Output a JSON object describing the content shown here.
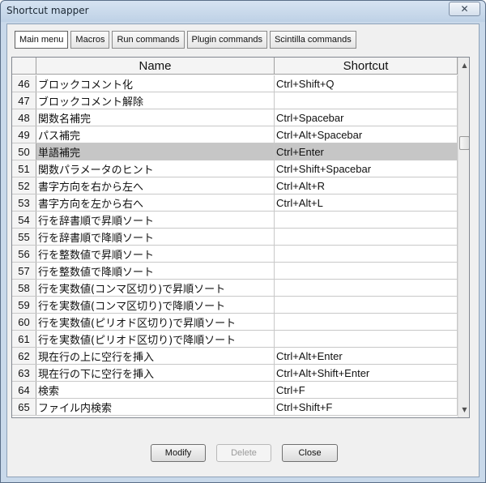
{
  "window": {
    "title": "Shortcut mapper",
    "close_glyph": "✕"
  },
  "tabs": [
    {
      "label": "Main menu",
      "active": true
    },
    {
      "label": "Macros",
      "active": false
    },
    {
      "label": "Run commands",
      "active": false
    },
    {
      "label": "Plugin commands",
      "active": false
    },
    {
      "label": "Scintilla commands",
      "active": false
    }
  ],
  "grid": {
    "headers": {
      "name": "Name",
      "shortcut": "Shortcut"
    },
    "selected_row": 50,
    "rows": [
      {
        "num": "46",
        "name": "ブロックコメント化",
        "shortcut": "Ctrl+Shift+Q"
      },
      {
        "num": "47",
        "name": "ブロックコメント解除",
        "shortcut": ""
      },
      {
        "num": "48",
        "name": "関数名補完",
        "shortcut": "Ctrl+Spacebar"
      },
      {
        "num": "49",
        "name": "パス補完",
        "shortcut": "Ctrl+Alt+Spacebar"
      },
      {
        "num": "50",
        "name": "単語補完",
        "shortcut": "Ctrl+Enter"
      },
      {
        "num": "51",
        "name": "関数パラメータのヒント",
        "shortcut": "Ctrl+Shift+Spacebar"
      },
      {
        "num": "52",
        "name": "書字方向を右から左へ",
        "shortcut": "Ctrl+Alt+R"
      },
      {
        "num": "53",
        "name": "書字方向を左から右へ",
        "shortcut": "Ctrl+Alt+L"
      },
      {
        "num": "54",
        "name": "行を辞書順で昇順ソート",
        "shortcut": ""
      },
      {
        "num": "55",
        "name": "行を辞書順で降順ソート",
        "shortcut": ""
      },
      {
        "num": "56",
        "name": "行を整数値で昇順ソート",
        "shortcut": ""
      },
      {
        "num": "57",
        "name": "行を整数値で降順ソート",
        "shortcut": ""
      },
      {
        "num": "58",
        "name": "行を実数値(コンマ区切り)で昇順ソート",
        "shortcut": ""
      },
      {
        "num": "59",
        "name": "行を実数値(コンマ区切り)で降順ソート",
        "shortcut": ""
      },
      {
        "num": "60",
        "name": "行を実数値(ピリオド区切り)で昇順ソート",
        "shortcut": ""
      },
      {
        "num": "61",
        "name": "行を実数値(ピリオド区切り)で降順ソート",
        "shortcut": ""
      },
      {
        "num": "62",
        "name": "現在行の上に空行を挿入",
        "shortcut": "Ctrl+Alt+Enter"
      },
      {
        "num": "63",
        "name": "現在行の下に空行を挿入",
        "shortcut": "Ctrl+Alt+Shift+Enter"
      },
      {
        "num": "64",
        "name": "検索",
        "shortcut": "Ctrl+F"
      },
      {
        "num": "65",
        "name": "ファイル内検索",
        "shortcut": "Ctrl+Shift+F"
      }
    ]
  },
  "scrollbar": {
    "up_icon": "scroll-up-arrow-icon",
    "down_icon": "scroll-down-arrow-icon",
    "up_glyph": "▲",
    "down_glyph": "▼"
  },
  "buttons": {
    "modify": "Modify",
    "delete": "Delete",
    "close": "Close"
  }
}
